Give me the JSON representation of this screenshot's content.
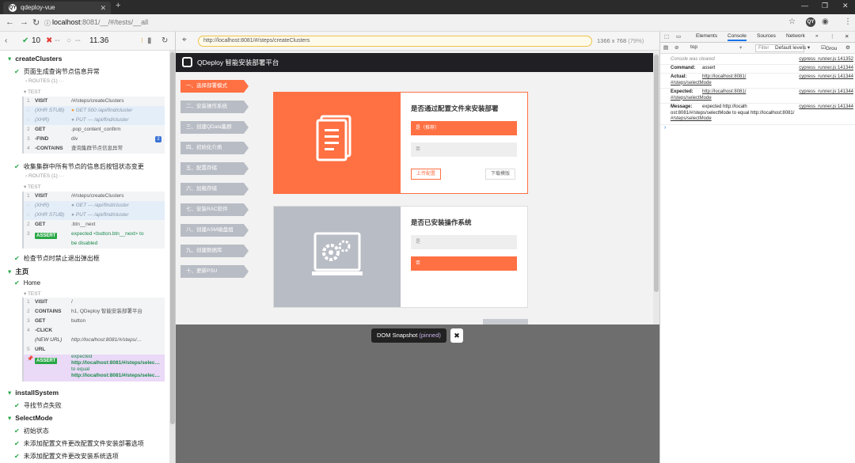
{
  "browser": {
    "tab_title": "qdeploy-vue",
    "favicon_text": "QY",
    "url_host": "localhost",
    "url_rest": ":8081/__/#/tests/__all"
  },
  "reporter": {
    "passed": "10",
    "failed": "--",
    "pending": "--",
    "duration": "11.36",
    "items": [
      {
        "type": "suite",
        "text": "createClusters"
      },
      {
        "type": "test",
        "text": "页面生成查询节点信息异常"
      },
      {
        "type": "routes",
        "text": "ROUTES (1)"
      },
      {
        "type": "section",
        "text": "TEST"
      },
      {
        "type": "test",
        "text": "收集集群中所有节点的信息后按钮状态变更"
      },
      {
        "type": "routes",
        "text": "ROUTES (1)"
      },
      {
        "type": "section",
        "text": "TEST"
      },
      {
        "type": "test",
        "text": "检查节点时禁止退出弹出框"
      },
      {
        "type": "suite",
        "text": "主页"
      },
      {
        "type": "test",
        "text": "Home"
      },
      {
        "type": "section",
        "text": "TEST"
      },
      {
        "type": "suite",
        "text": "installSystem"
      },
      {
        "type": "test",
        "text": "寻找节点失败"
      },
      {
        "type": "suite",
        "text": "SelectMode"
      },
      {
        "type": "test",
        "text": "初始状态"
      },
      {
        "type": "test",
        "text": "未添加配置文件更改配置文件安装部署选项"
      },
      {
        "type": "test",
        "text": "未添加配置文件更改安装系统选项"
      }
    ],
    "block1": [
      {
        "n": "1",
        "k": "VISIT",
        "v": "/#/steps/createClusters",
        "cls": ""
      },
      {
        "n": "",
        "k": "(XHR STUB)",
        "v": "GET 500 /api/find/cluster",
        "cls": "stub",
        "dot": "o"
      },
      {
        "n": "",
        "k": "(XHR)",
        "v": "PUT --- /api/find/cluster",
        "cls": "stub",
        "dot": "g"
      },
      {
        "n": "2",
        "k": "GET",
        "v": ".pop_content_confirm",
        "cls": ""
      },
      {
        "n": "3",
        "k": "-FIND",
        "v": "div",
        "cls": "",
        "badge": "2"
      },
      {
        "n": "4",
        "k": "-CONTAINS",
        "v": "查询集群节点信息异常",
        "cls": ""
      }
    ],
    "block2": [
      {
        "n": "1",
        "k": "VISIT",
        "v": "/#/steps/createClusters",
        "cls": ""
      },
      {
        "n": "",
        "k": "(XHR)",
        "v": "GET --- /api/find/cluster",
        "cls": "stub",
        "dot": "g"
      },
      {
        "n": "",
        "k": "(XHR STUB)",
        "v": "PUT --- /api/find/cluster",
        "cls": "stub",
        "dot": "g"
      },
      {
        "n": "2",
        "k": "GET",
        "v": ".btn__next",
        "cls": ""
      }
    ],
    "block2_assert": {
      "n": "3",
      "k": "ASSERT",
      "v1": "expected <button.btn__next> to",
      "v2": "be disabled"
    },
    "block3": [
      {
        "n": "1",
        "k": "VISIT",
        "v": "/",
        "cls": ""
      },
      {
        "n": "2",
        "k": "CONTAINS",
        "v": "h1, QDeploy 智能安装部署平台",
        "cls": ""
      },
      {
        "n": "3",
        "k": "GET",
        "v": "button",
        "cls": ""
      },
      {
        "n": "4",
        "k": "-CLICK",
        "v": "",
        "cls": ""
      },
      {
        "n": "",
        "k": "(NEW URL)",
        "v": "http://localhost:8081/#/steps/…",
        "cls": "newurl"
      },
      {
        "n": "5",
        "k": "URL",
        "v": "",
        "cls": ""
      }
    ],
    "block3_assert": {
      "n": "6",
      "k": "ASSERT",
      "v1": "expected",
      "v2": "http://localhost:8081/#/steps/selec…",
      "v3": "to equal",
      "v4": "http://localhost:8081/#/steps/selec…"
    }
  },
  "aut": {
    "url": "http://localhost:8081/#/steps/createClusters",
    "size": "1366 x 768",
    "zoom": "(79%)",
    "app_title": "QDeploy 智能安装部署平台",
    "steps": [
      "一、选择部署模式",
      "二、安装操作系统",
      "三、创建QData集群",
      "四、初始化介质",
      "五、配置存储",
      "六、加载存储",
      "七、安装RAC软件",
      "八、创建ASM磁盘组",
      "九、创建数据库",
      "十、更新PSU"
    ],
    "active_step": 0,
    "card1": {
      "title": "是否通过配置文件来安装部署",
      "opt_yes": "是（推荐）",
      "opt_no": "否",
      "upload": "上传配置",
      "download": "下载模版"
    },
    "card2": {
      "title": "是否已安装操作系统",
      "opt_yes": "是",
      "opt_no": "否"
    },
    "snapshot_label": "DOM Snapshot",
    "snapshot_pinned": "(pinned)",
    "snapshot_close": "✖"
  },
  "devtools": {
    "tabs": [
      "Elements",
      "Console",
      "Sources",
      "Network"
    ],
    "active_tab": "Console",
    "context": "top",
    "filter_placeholder": "Filter",
    "levels": "Default levels ▾",
    "group": "Grou",
    "cleared": "Console was cleared",
    "src1": "cypress_runner.js:141352",
    "src": "cypress_runner.js:141344",
    "command_k": "Command:",
    "command_v": "assert",
    "actual_k": "Actual:",
    "actual_v1": "http://localhost:8081/",
    "actual_v2": "#/steps/selectMode",
    "expected_k": "Expected:",
    "expected_v1": "http://localhost:8081/",
    "expected_v2": "#/steps/selectMode",
    "message_k": "Message:",
    "message_v1": "expected http://localh",
    "message_v2": "ost:8081/#/steps/selectMode to equal http://localhost:8081/",
    "message_v3": "#/steps/selectMode"
  },
  "colors": {
    "accent": "#ff7043",
    "pass": "#28a745",
    "fail": "#e53935",
    "pin": "#ead9f7"
  }
}
